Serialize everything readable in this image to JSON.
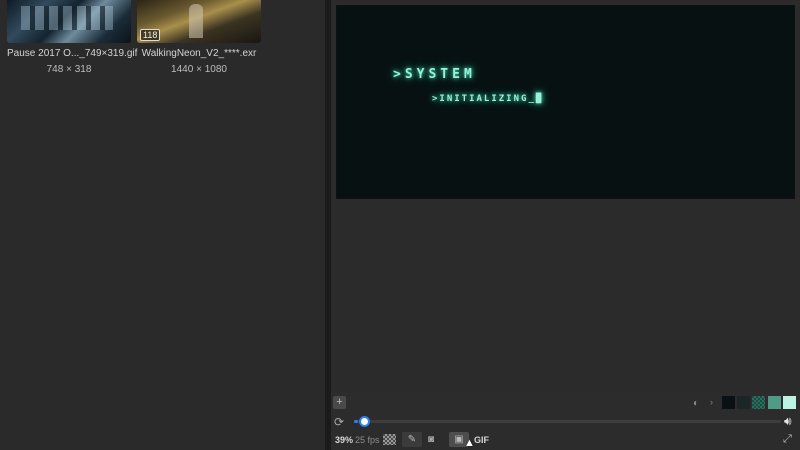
{
  "browser": {
    "assets": [
      {
        "name": "Pause 2017 O..._749×319.gif",
        "dimensions": "748 × 318",
        "icon": "thumbnail-gif"
      },
      {
        "name": "WalkingNeon_V2_****.exr",
        "dimensions": "1440 × 1080",
        "frame_count": "118",
        "icon": "thumbnail-sequence"
      }
    ]
  },
  "viewer": {
    "canvas_line1": ">SYSTEM",
    "canvas_line2": ">INITIALIZING_█",
    "canvas_text_color": "#9af0d8"
  },
  "controls": {
    "add_label": "+",
    "background_swatches": [
      "#0a1114",
      "#1d2627",
      "checker-teal",
      "#4f9b86",
      "#bdf3e2"
    ],
    "playback_progress": 0.01,
    "zoom": "39%",
    "fps": "25 fps",
    "format_label": "GIF",
    "accent_color": "#2b7ff0"
  }
}
